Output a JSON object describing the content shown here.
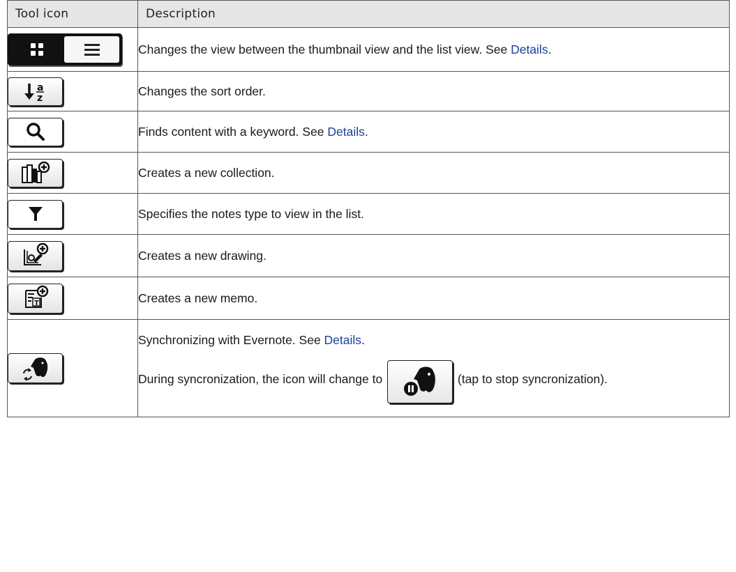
{
  "header": {
    "col1": "Tool icon",
    "col2": "Description"
  },
  "rows": [
    {
      "icon": "thumbnail-list-toggle-icon",
      "parts": [
        "Changes the view between the thumbnail view and the list view. See ",
        "Details",
        "."
      ]
    },
    {
      "icon": "sort-order-icon",
      "sort_glyph": "a z",
      "parts": [
        "Changes the sort order."
      ]
    },
    {
      "icon": "search-icon",
      "parts": [
        "Finds content with a keyword. See ",
        "Details",
        "."
      ]
    },
    {
      "icon": "new-collection-icon",
      "parts": [
        "Creates a new collection."
      ]
    },
    {
      "icon": "filter-icon",
      "parts": [
        "Specifies the notes type to view in the list."
      ]
    },
    {
      "icon": "new-drawing-icon",
      "parts": [
        "Creates a new drawing."
      ]
    },
    {
      "icon": "new-memo-icon",
      "parts": [
        "Creates a new memo."
      ]
    },
    {
      "icon": "evernote-sync-icon",
      "line1": [
        "Synchronizing with Evernote. See ",
        "Details",
        "."
      ],
      "line2_before": "During syncronization, the icon will change to ",
      "line2_after": " (tap to stop syncronization).",
      "inline_icon": "evernote-stop-sync-icon"
    }
  ],
  "colors": {
    "link": "#1a3f9e",
    "header_bg": "#e6e6e6",
    "border": "#555555"
  }
}
